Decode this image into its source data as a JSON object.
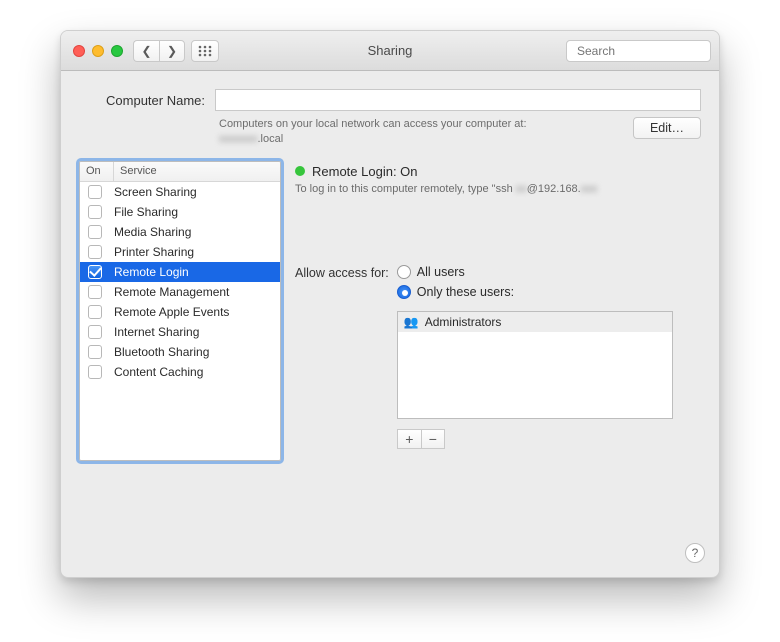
{
  "window": {
    "title": "Sharing",
    "search_placeholder": "Search"
  },
  "nameSection": {
    "label": "Computer Name:",
    "value": "",
    "bonjour_line1": "Computers on your local network can access your computer at:",
    "bonjour_hostname_suffix": ".local",
    "edit_label": "Edit…"
  },
  "servicesTable": {
    "col_on": "On",
    "col_service": "Service",
    "items": [
      {
        "label": "Screen Sharing",
        "checked": false,
        "selected": false
      },
      {
        "label": "File Sharing",
        "checked": false,
        "selected": false
      },
      {
        "label": "Media Sharing",
        "checked": false,
        "selected": false
      },
      {
        "label": "Printer Sharing",
        "checked": false,
        "selected": false
      },
      {
        "label": "Remote Login",
        "checked": true,
        "selected": true
      },
      {
        "label": "Remote Management",
        "checked": false,
        "selected": false
      },
      {
        "label": "Remote Apple Events",
        "checked": false,
        "selected": false
      },
      {
        "label": "Internet Sharing",
        "checked": false,
        "selected": false
      },
      {
        "label": "Bluetooth Sharing",
        "checked": false,
        "selected": false
      },
      {
        "label": "Content Caching",
        "checked": false,
        "selected": false
      }
    ]
  },
  "detail": {
    "status_text": "Remote Login: On",
    "hint_prefix": "To log in to this computer remotely, type \"ssh ",
    "hint_ip": "@192.168.",
    "allow_label": "Allow access for:",
    "radio_all": "All users",
    "radio_only": "Only these users:",
    "selected_radio": "only",
    "users": [
      {
        "name": "Administrators"
      }
    ]
  }
}
